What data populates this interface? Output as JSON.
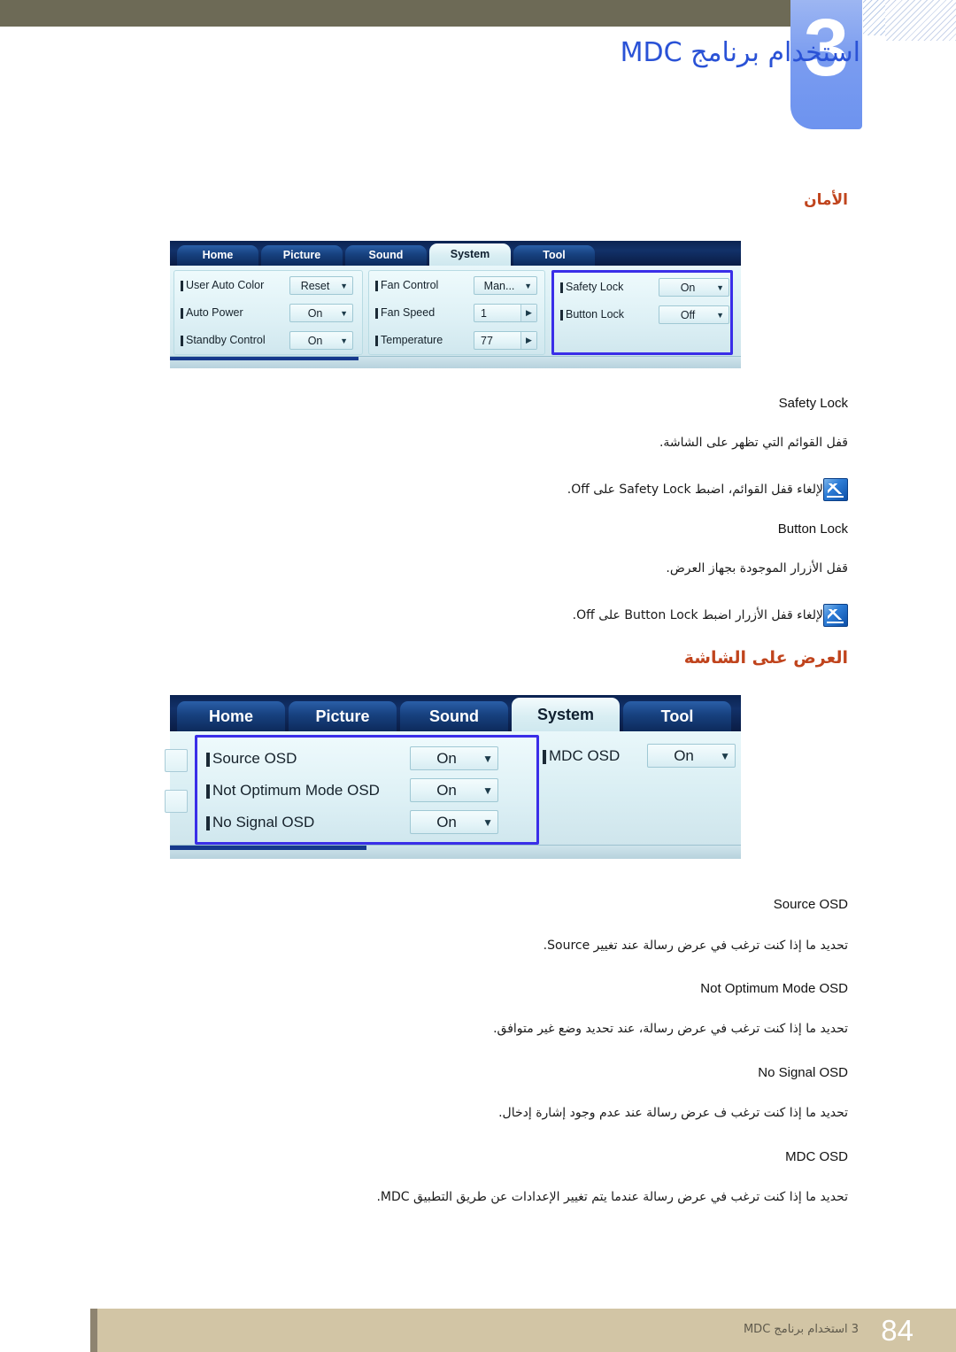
{
  "header": {
    "chapter_number": "3",
    "chapter_title": "استخدام برنامج MDC"
  },
  "sections": [
    {
      "heading": "الأمان",
      "panel": {
        "tabs": [
          {
            "label": "Home",
            "active": false
          },
          {
            "label": "Picture",
            "active": false
          },
          {
            "label": "Sound",
            "active": false
          },
          {
            "label": "System",
            "active": true
          },
          {
            "label": "Tool",
            "active": false
          }
        ],
        "groups": [
          {
            "highlight": false,
            "rows": [
              {
                "label": "User Auto Color",
                "value": "Reset",
                "control": "dropdown"
              },
              {
                "label": "Auto Power",
                "value": "On",
                "control": "dropdown"
              },
              {
                "label": "Standby Control",
                "value": "On",
                "control": "dropdown"
              }
            ]
          },
          {
            "highlight": false,
            "rows": [
              {
                "label": "Fan Control",
                "value": "Man...",
                "control": "dropdown"
              },
              {
                "label": "Fan Speed",
                "value": "1",
                "control": "spinner"
              },
              {
                "label": "Temperature",
                "value": "77",
                "control": "spinner"
              }
            ]
          },
          {
            "highlight": true,
            "rows": [
              {
                "label": "Safety Lock",
                "value": "On",
                "control": "dropdown"
              },
              {
                "label": "Button Lock",
                "value": "Off",
                "control": "dropdown"
              }
            ]
          }
        ]
      },
      "entries": [
        {
          "term": "Safety Lock",
          "desc": "قفل القوائم التي تظهر على الشاشة.",
          "note": "لإلغاء قفل القوائم، اضبط Safety Lock على Off."
        },
        {
          "term": "Button Lock",
          "desc": "قفل الأزرار الموجودة بجهاز العرض.",
          "note": "لإلغاء قفل الأزرار اضبط Button Lock على Off."
        }
      ]
    },
    {
      "heading": "العرض على الشاشة",
      "panel": {
        "tabs": [
          {
            "label": "Home",
            "active": false
          },
          {
            "label": "Picture",
            "active": false
          },
          {
            "label": "Sound",
            "active": false
          },
          {
            "label": "System",
            "active": true
          },
          {
            "label": "Tool",
            "active": false
          }
        ],
        "groups": [
          {
            "highlight": true,
            "rows": [
              {
                "label": "Source OSD",
                "value": "On",
                "control": "dropdown"
              },
              {
                "label": "Not Optimum Mode OSD",
                "value": "On",
                "control": "dropdown"
              },
              {
                "label": "No Signal OSD",
                "value": "On",
                "control": "dropdown"
              }
            ]
          },
          {
            "highlight": false,
            "rows": [
              {
                "label": "MDC OSD",
                "value": "On",
                "control": "dropdown"
              }
            ]
          }
        ]
      },
      "entries": [
        {
          "term": "Source OSD",
          "desc": "تحديد ما إذا كنت ترغب في عرض رسالة عند تغيير Source."
        },
        {
          "term": "Not Optimum Mode OSD",
          "desc": "تحديد ما إذا كنت ترغب في عرض رسالة، عند تحديد وضع غير متوافق."
        },
        {
          "term": "No Signal OSD",
          "desc": "تحديد ما إذا كنت ترغب ف عرض رسالة عند عدم وجود إشارة إدخال."
        },
        {
          "term": "MDC OSD",
          "desc": "تحديد ما إذا كنت ترغب في عرض رسالة عندما يتم تغيير الإعدادات عن طريق التطبيق MDC."
        }
      ]
    }
  ],
  "footer": {
    "page_number": "84",
    "text": "3 استخدام برنامج MDC"
  },
  "colors": {
    "olive_bar": "#6d6a56",
    "chapter_blue": "#2a52d6",
    "heading_red": "#c0441d",
    "highlight_border": "#3a2ee8",
    "footer_bar": "#d2c5a5"
  }
}
